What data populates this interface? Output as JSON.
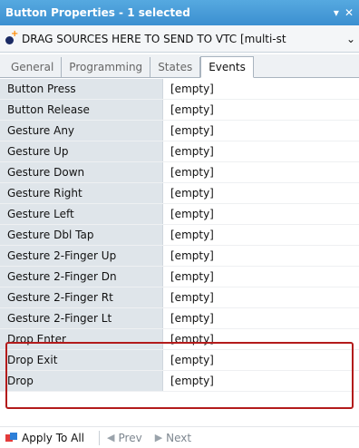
{
  "titlebar": {
    "title": "Button Properties - 1 selected",
    "pin_icon": "▾",
    "close_icon": "✕"
  },
  "source": {
    "label": "DRAG SOURCES HERE TO SEND TO VTC  [multi-st",
    "dropdown_icon": "⌄"
  },
  "tabs": [
    {
      "label": "General"
    },
    {
      "label": "Programming"
    },
    {
      "label": "States"
    },
    {
      "label": "Events",
      "active": true
    }
  ],
  "events": [
    {
      "name": "Button Press",
      "value": "[empty]"
    },
    {
      "name": "Button Release",
      "value": "[empty]"
    },
    {
      "name": "Gesture Any",
      "value": "[empty]"
    },
    {
      "name": "Gesture Up",
      "value": "[empty]"
    },
    {
      "name": "Gesture Down",
      "value": "[empty]"
    },
    {
      "name": "Gesture Right",
      "value": "[empty]"
    },
    {
      "name": "Gesture Left",
      "value": "[empty]"
    },
    {
      "name": "Gesture Dbl Tap",
      "value": "[empty]"
    },
    {
      "name": "Gesture 2-Finger Up",
      "value": "[empty]"
    },
    {
      "name": "Gesture 2-Finger Dn",
      "value": "[empty]"
    },
    {
      "name": "Gesture 2-Finger Rt",
      "value": "[empty]"
    },
    {
      "name": "Gesture 2-Finger Lt",
      "value": "[empty]"
    },
    {
      "name": "Drop Enter",
      "value": "[empty]"
    },
    {
      "name": "Drop Exit",
      "value": "[empty]"
    },
    {
      "name": "Drop",
      "value": "[empty]"
    }
  ],
  "footer": {
    "apply_label": "Apply To All",
    "prev_label": "Prev",
    "next_label": "Next"
  },
  "colors": {
    "titlebar": "#3b8fd0",
    "highlight": "#b31b1b"
  }
}
